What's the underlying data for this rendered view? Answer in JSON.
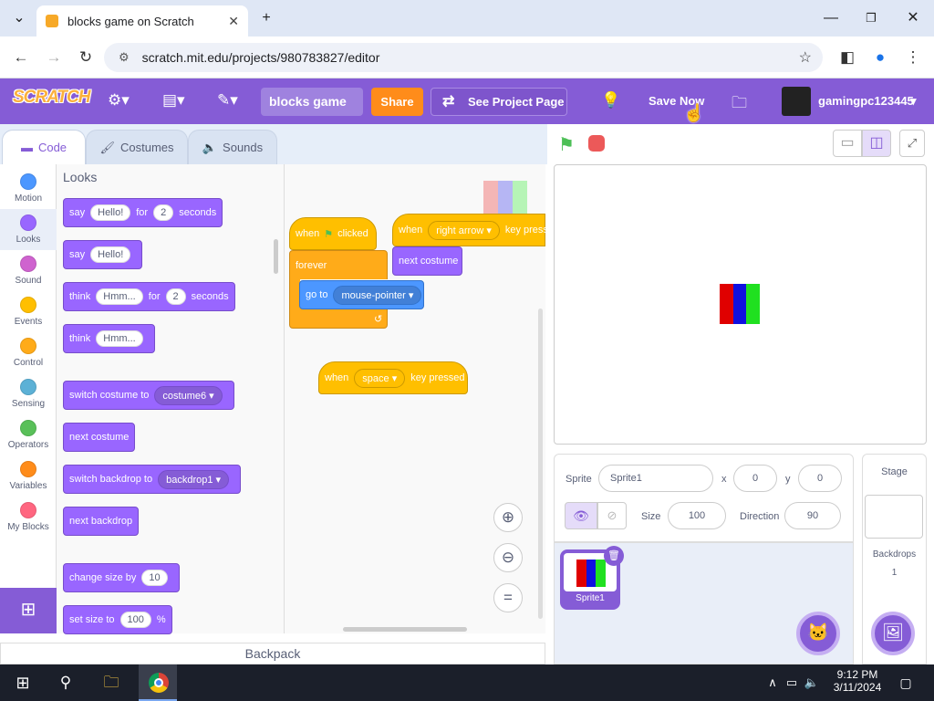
{
  "browser": {
    "tab_title": "blocks game on Scratch",
    "url": "scratch.mit.edu/projects/980783827/editor"
  },
  "menu": {
    "logo": "SCRATCH",
    "project_title": "blocks game",
    "share": "Share",
    "see_project": "See Project Page",
    "save_now": "Save Now",
    "username": "gamingpc123445"
  },
  "tabs": {
    "code": "Code",
    "costumes": "Costumes",
    "sounds": "Sounds"
  },
  "categories": [
    {
      "label": "Motion",
      "color": "#4c97ff"
    },
    {
      "label": "Looks",
      "color": "#9966ff"
    },
    {
      "label": "Sound",
      "color": "#cf63cf"
    },
    {
      "label": "Events",
      "color": "#ffbf00"
    },
    {
      "label": "Control",
      "color": "#ffab19"
    },
    {
      "label": "Sensing",
      "color": "#5cb1d6"
    },
    {
      "label": "Operators",
      "color": "#59c059"
    },
    {
      "label": "Variables",
      "color": "#ff8c1a"
    },
    {
      "label": "My Blocks",
      "color": "#ff6680"
    }
  ],
  "palette": {
    "title": "Looks",
    "say_timed": {
      "t1": "say",
      "v1": "Hello!",
      "t2": "for",
      "v2": "2",
      "t3": "seconds"
    },
    "say": {
      "t1": "say",
      "v1": "Hello!"
    },
    "think_timed": {
      "t1": "think",
      "v1": "Hmm...",
      "t2": "for",
      "v2": "2",
      "t3": "seconds"
    },
    "think": {
      "t1": "think",
      "v1": "Hmm..."
    },
    "switch_costume": {
      "t1": "switch costume to",
      "v1": "costume6"
    },
    "next_costume": "next costume",
    "switch_backdrop": {
      "t1": "switch backdrop to",
      "v1": "backdrop1"
    },
    "next_backdrop": "next backdrop",
    "change_size": {
      "t1": "change size by",
      "v1": "10"
    },
    "set_size": {
      "t1": "set size to",
      "v1": "100",
      "t2": "%"
    }
  },
  "scripts": {
    "flag_hat": {
      "t1": "when",
      "t2": "clicked"
    },
    "forever": "forever",
    "goto": {
      "t1": "go to",
      "v1": "mouse-pointer"
    },
    "key_hat1": {
      "t1": "when",
      "v1": "right arrow",
      "t2": "key pressed"
    },
    "next_costume": "next costume",
    "key_hat2": {
      "t1": "when",
      "v1": "space",
      "t2": "key pressed"
    }
  },
  "sprite_info": {
    "sprite_label": "Sprite",
    "sprite_name": "Sprite1",
    "x_label": "x",
    "x": "0",
    "y_label": "y",
    "y": "0",
    "size_label": "Size",
    "size": "100",
    "direction_label": "Direction",
    "direction": "90"
  },
  "sprite_list": {
    "thumb_label": "Sprite1"
  },
  "stage_panel": {
    "title": "Stage",
    "backdrops_label": "Backdrops",
    "backdrops_count": "1"
  },
  "backpack": "Backpack",
  "taskbar": {
    "time": "9:12 PM",
    "date": "3/11/2024"
  },
  "colors": {
    "scratch_purple": "#855cd6",
    "looks": "#9966ff",
    "events": "#ffbf00",
    "motion": "#4c97ff",
    "control": "#ffab19"
  }
}
